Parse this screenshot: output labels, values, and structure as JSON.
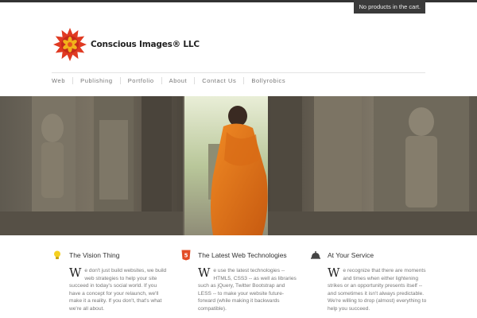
{
  "cart": {
    "label": "No products in the cart."
  },
  "brand": {
    "name": "Conscious Images® LLC"
  },
  "nav": {
    "items": [
      "Web",
      "Publishing",
      "Portfolio",
      "About",
      "Contact Us",
      "Bollyrobics"
    ]
  },
  "features": [
    {
      "title": "The Vision Thing",
      "icon": "lightbulb-icon",
      "dropcap": "W",
      "body": "e don't just build websites, we build web strategies to help your site succeed in today's social world. If you have a concept for your relaunch, we'll make it a reality. If you don't, that's what we're all about."
    },
    {
      "title": "The Latest Web Technologies",
      "icon": "html5-icon",
      "dropcap": "W",
      "body": "e use the latest technologies -- HTML5, CSS3 -- as well as libraries such as jQuery, Twitter Bootstrap and LESS -- to make your website future-forward (while making it backwards compatible)."
    },
    {
      "title": "At Your Service",
      "icon": "service-bell-icon",
      "dropcap": "W",
      "body": "e recognize that there are moments and times when either lightening strikes or an opportunity presents itself -- and sometimes it isn't always predictable. We're willing to drop (almost) everything to help you succeed."
    }
  ],
  "colors": {
    "accent": "#e8511f",
    "logo_yellow": "#f2b21b",
    "nav_text": "#777777",
    "dark_bar": "#333333"
  }
}
